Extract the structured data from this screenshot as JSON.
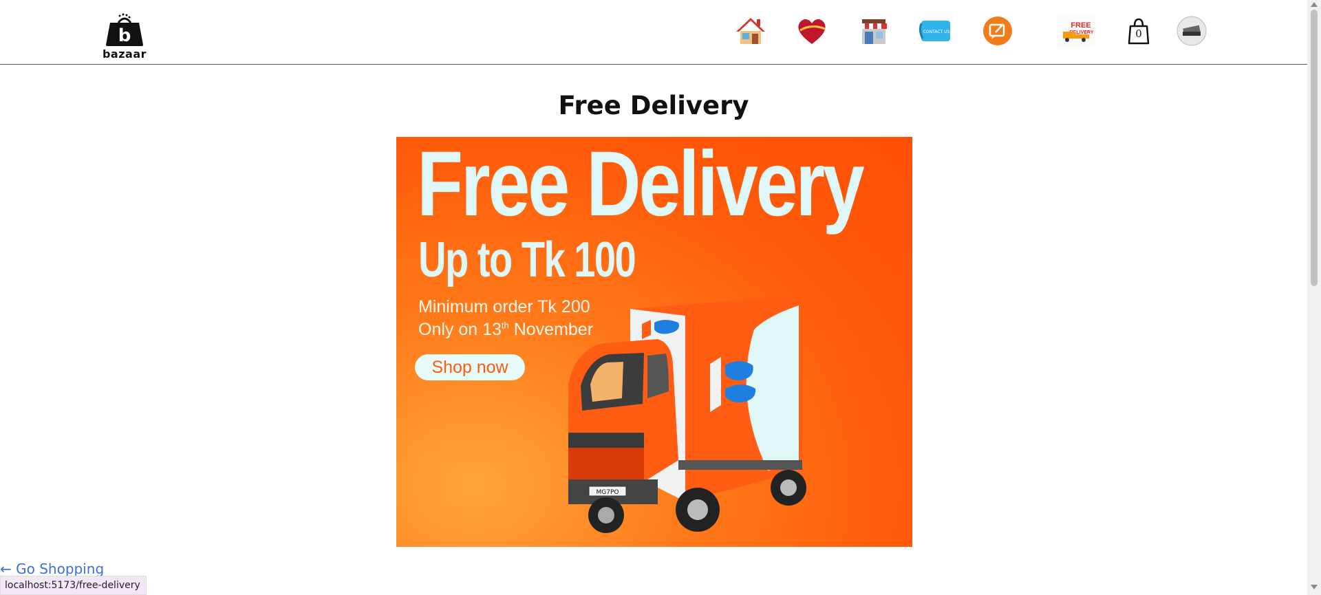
{
  "header": {
    "logo_text": "bazaar",
    "logo_letter": "b",
    "nav_icons": [
      "home-icon",
      "wishlist-heart-icon",
      "shop-icon",
      "contact-us-icon",
      "blog-icon",
      "free-delivery-icon",
      "cart-icon",
      "profile-icon"
    ],
    "contact_text": "CONTACT US",
    "free_delivery_text_1": "FREE",
    "free_delivery_text_2": "DELIVERY",
    "cart_count": "0"
  },
  "main": {
    "title": "Free Delivery",
    "banner": {
      "headline": "Free Delivery",
      "subheadline": "Up to Tk 100",
      "line1": "Minimum order Tk 200",
      "line2_prefix": "Only on 13",
      "line2_sup": "th",
      "line2_suffix": " November",
      "button": "Shop now",
      "plate": "MG7PO"
    },
    "go_shopping": "← Go Shopping"
  },
  "status_bar": {
    "url": "localhost:5173/free-delivery"
  },
  "colors": {
    "banner_orange": "#ff5a0a",
    "banner_text": "#dff7f6",
    "link_blue": "#3b6fe0"
  }
}
